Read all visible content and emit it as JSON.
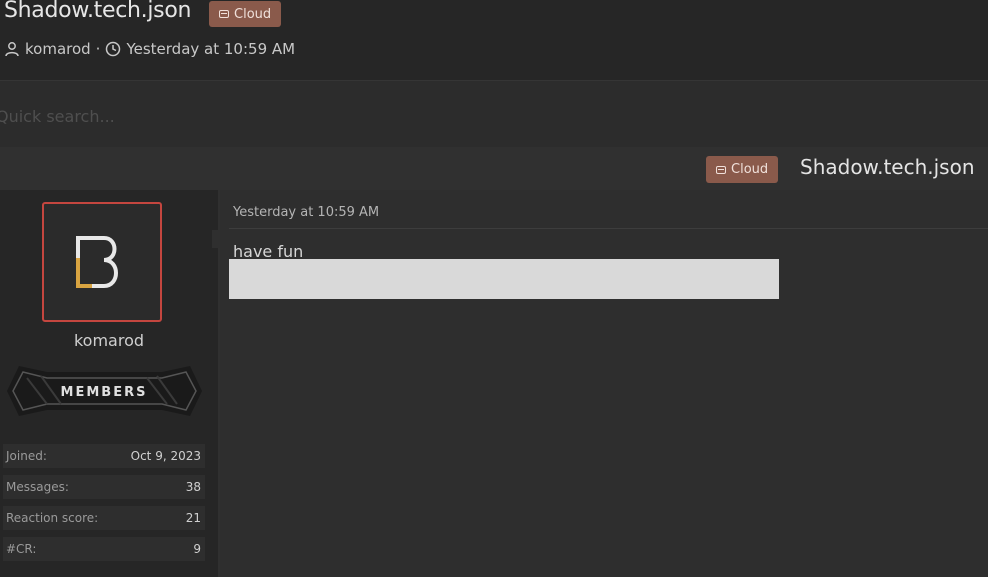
{
  "thread": {
    "title": "Shadow.tech.json",
    "tag": "Cloud",
    "author": "komarod",
    "separator": "·",
    "timestamp": "Yesterday at 10:59 AM"
  },
  "search": {
    "placeholder": "Quick search..."
  },
  "post": {
    "title": "Shadow.tech.json",
    "tag": "Cloud",
    "date": "Yesterday at 10:59 AM",
    "text": "have fun"
  },
  "user": {
    "name": "komarod",
    "banner_text": "MEMBERS",
    "stats": [
      {
        "label": "Joined:",
        "value": "Oct 9, 2023"
      },
      {
        "label": "Messages:",
        "value": "38"
      },
      {
        "label": "Reaction score:",
        "value": "21"
      },
      {
        "label": "#CR:",
        "value": "9"
      }
    ]
  },
  "colors": {
    "tag_bg": "#8a5a4b",
    "avatar_border": "#c4463f",
    "logo_accent": "#d9a441"
  },
  "icons": [
    "user-icon",
    "clock-icon",
    "tag-icon"
  ]
}
